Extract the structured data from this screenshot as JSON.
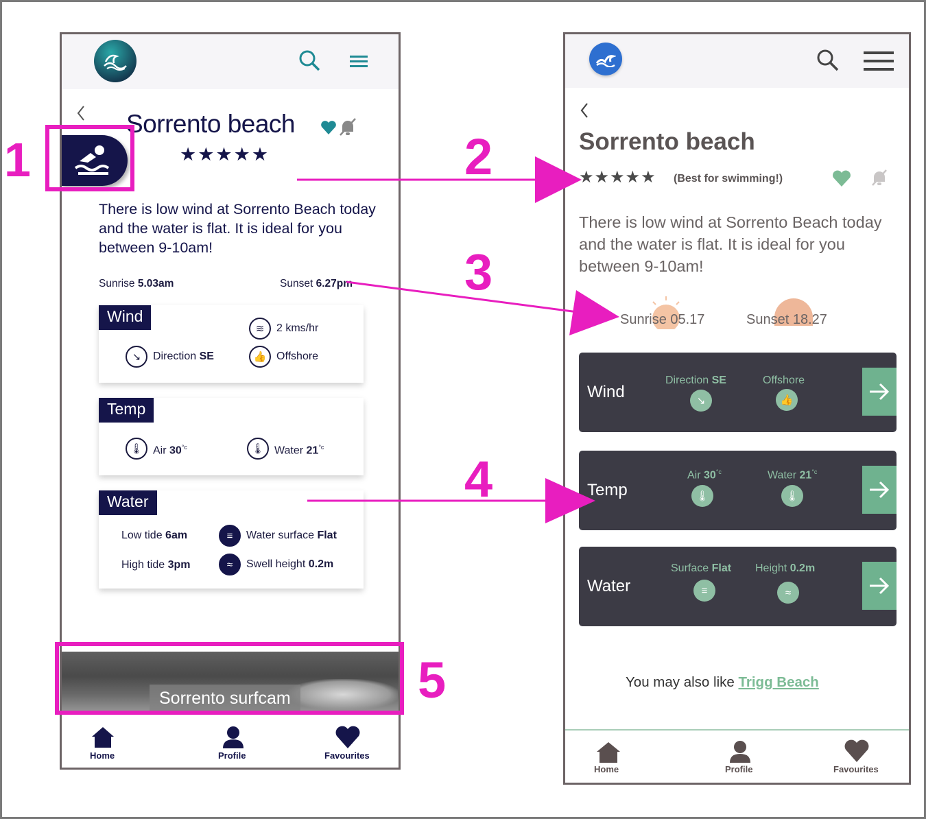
{
  "left": {
    "title": "Sorrento beach",
    "stars": "★★★★★",
    "description": "There is low wind at Sorrento Beach today and the water is flat. It is ideal for you between 9-10am!",
    "sunrise_label": "Sunrise",
    "sunrise_value": "5.03am",
    "sunset_label": "Sunset",
    "sunset_value": "6.27pm",
    "wind": {
      "title": "Wind",
      "speed": "2 kms/hr",
      "direction_label": "Direction",
      "direction_value": "SE",
      "offshore": "Offshore"
    },
    "temp": {
      "title": "Temp",
      "air_label": "Air",
      "air_value": "30",
      "water_label": "Water",
      "water_value": "21",
      "unit": "°c"
    },
    "water": {
      "title": "Water",
      "low_label": "Low tide",
      "low_value": "6am",
      "high_label": "High tide",
      "high_value": "3pm",
      "surface_label": "Water surface",
      "surface_value": "Flat",
      "swell_label": "Swell height",
      "swell_value": "0.2m"
    },
    "surfcam": "Sorrento surfcam",
    "nav": {
      "home": "Home",
      "profile": "Profile",
      "favourites": "Favourites"
    }
  },
  "right": {
    "title": "Sorrento beach",
    "stars": "★★★★★",
    "best_for": "(Best for swimming!)",
    "description": "There is low wind at Sorrento Beach today and the water is flat. It is ideal for you between 9-10am!",
    "sunrise": "Sunrise 05.17",
    "sunset": "Sunset 18.27",
    "wind": {
      "title": "Wind",
      "direction_label": "Direction",
      "direction_value": "SE",
      "offshore": "Offshore"
    },
    "temp": {
      "title": "Temp",
      "air_label": "Air",
      "air_value": "30",
      "water_label": "Water",
      "water_value": "21",
      "unit": "°c"
    },
    "water": {
      "title": "Water",
      "surface_label": "Surface",
      "surface_value": "Flat",
      "height_label": "Height",
      "height_value": "0.2m"
    },
    "also_like": "You may also like",
    "also_like_link": "Trigg Beach",
    "nav": {
      "home": "Home",
      "profile": "Profile",
      "favourites": "Favourites"
    }
  },
  "annotations": [
    "1",
    "2",
    "3",
    "4",
    "5"
  ],
  "colors": {
    "navy": "#15154a",
    "teal": "#1f8a94",
    "pink": "#e81ebf",
    "sage": "#8fbfa4",
    "dark_card": "#3c3b45"
  }
}
